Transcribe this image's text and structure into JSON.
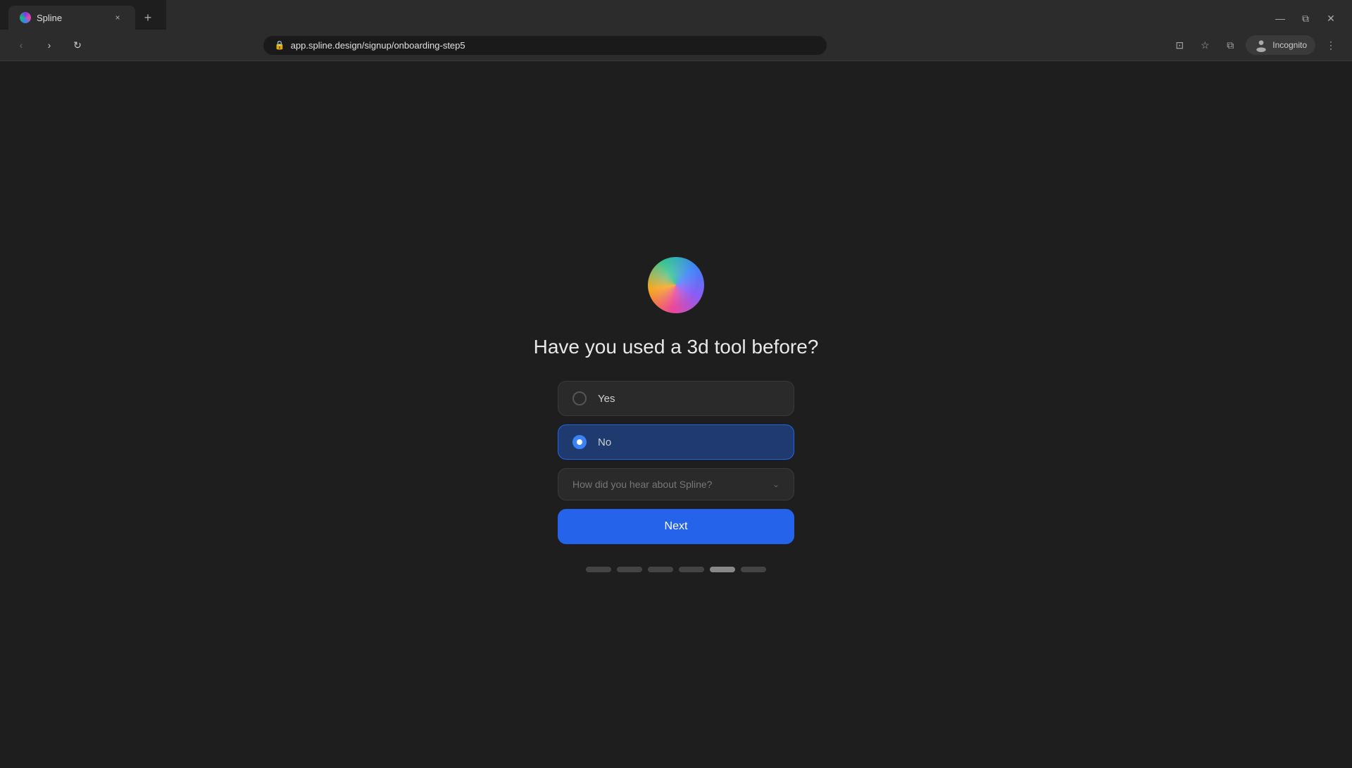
{
  "browser": {
    "tab": {
      "favicon_alt": "Spline logo",
      "title": "Spline",
      "close_label": "×"
    },
    "new_tab_label": "+",
    "toolbar": {
      "back_label": "‹",
      "forward_label": "›",
      "reload_label": "↻",
      "url": "app.spline.design/signup/onboarding-step5",
      "lock_icon": "🔒",
      "cast_icon": "⊡",
      "bookmark_icon": "☆",
      "sidebar_icon": "⧉",
      "incognito_label": "Incognito",
      "menu_icon": "⋮",
      "minimize_label": "—",
      "maximize_label": "⧉",
      "close_label": "✕"
    }
  },
  "page": {
    "logo_alt": "Spline 3D sphere logo",
    "question": "Have you used a 3d tool before?",
    "options": [
      {
        "id": "yes",
        "label": "Yes",
        "selected": false
      },
      {
        "id": "no",
        "label": "No",
        "selected": true
      }
    ],
    "dropdown": {
      "placeholder": "How did you hear about Spline?",
      "chevron": "⌄"
    },
    "next_button": "Next",
    "progress": {
      "dots": [
        {
          "id": 1,
          "active": false
        },
        {
          "id": 2,
          "active": false
        },
        {
          "id": 3,
          "active": false
        },
        {
          "id": 4,
          "active": false
        },
        {
          "id": 5,
          "active": true
        },
        {
          "id": 6,
          "active": false
        }
      ]
    }
  }
}
